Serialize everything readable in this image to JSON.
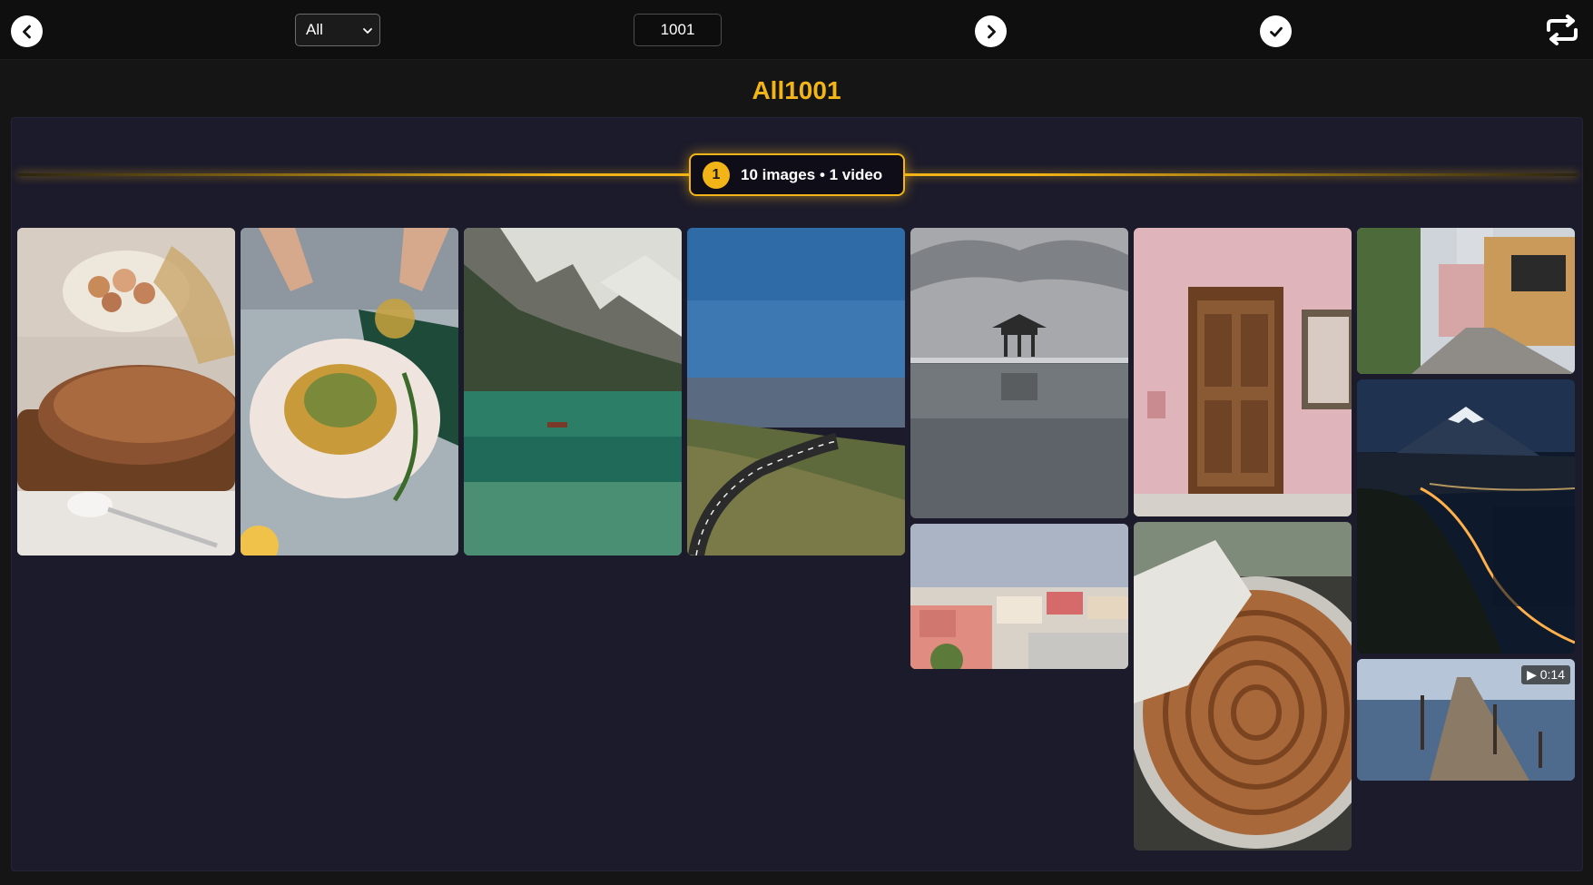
{
  "toolbar": {
    "filter_value": "All",
    "number_value": "1001"
  },
  "page_title": "All1001",
  "group": {
    "index": "1",
    "summary": "10 images • 1 video"
  },
  "tiles": [
    {
      "name": "bread-eggs-image",
      "kind": "image"
    },
    {
      "name": "artichoke-dish-image",
      "kind": "image"
    },
    {
      "name": "mountain-lake-image",
      "kind": "image"
    },
    {
      "name": "coastal-road-image",
      "kind": "image"
    },
    {
      "name": "pavilion-water-image",
      "kind": "image"
    },
    {
      "name": "pink-wall-door-image",
      "kind": "image"
    },
    {
      "name": "city-street-image",
      "kind": "image"
    },
    {
      "name": "pink-houses-image",
      "kind": "image"
    },
    {
      "name": "baked-pastry-image",
      "kind": "image"
    },
    {
      "name": "mount-fuji-night-image",
      "kind": "image"
    },
    {
      "name": "wooden-pier-video",
      "kind": "video",
      "duration": "▶ 0:14"
    }
  ],
  "colors": {
    "accent": "#f2b417",
    "panel": "#1c1b2b",
    "background": "#151515"
  }
}
